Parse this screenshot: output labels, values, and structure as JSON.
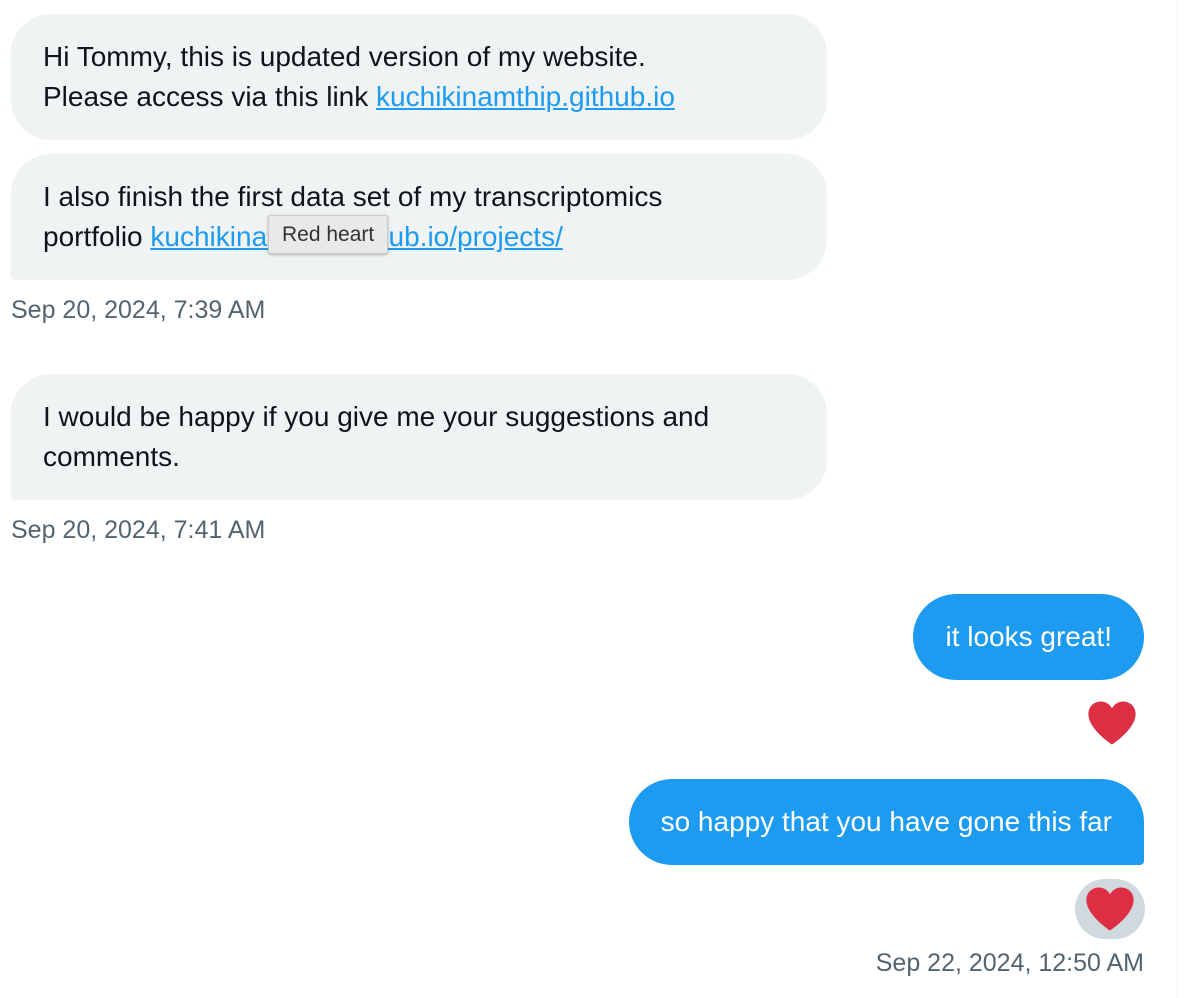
{
  "conversation": {
    "messages_in": [
      {
        "text": "Hi Tommy, this is updated version of my website.",
        "text2": "Please access via this link ",
        "link": "kuchikinamthip.github.io"
      },
      {
        "text": "I also finish the first data set of my  transcriptomics",
        "text2": "portfolio ",
        "link": "kuchikinamthip.github.io/projects/"
      },
      {
        "text": "I would be happy if you give me your suggestions and",
        "text2": "comments."
      }
    ],
    "timestamps_in": [
      "Sep 20, 2024, 7:39 AM",
      "Sep 20, 2024, 7:41 AM"
    ],
    "messages_out": [
      {
        "text": "it looks great!",
        "reaction": "red-heart"
      },
      {
        "text": "so happy that you have gone this far",
        "reaction": "red-heart"
      }
    ],
    "timestamp_out": "Sep 22, 2024, 12:50 AM"
  },
  "tooltip": {
    "text": "Red heart"
  },
  "colors": {
    "incoming_bubble": "#eff3f4",
    "outgoing_bubble": "#1d9bf0",
    "link": "#1d9bf0",
    "heart": "#dd2e44",
    "timestamp": "#536471"
  }
}
